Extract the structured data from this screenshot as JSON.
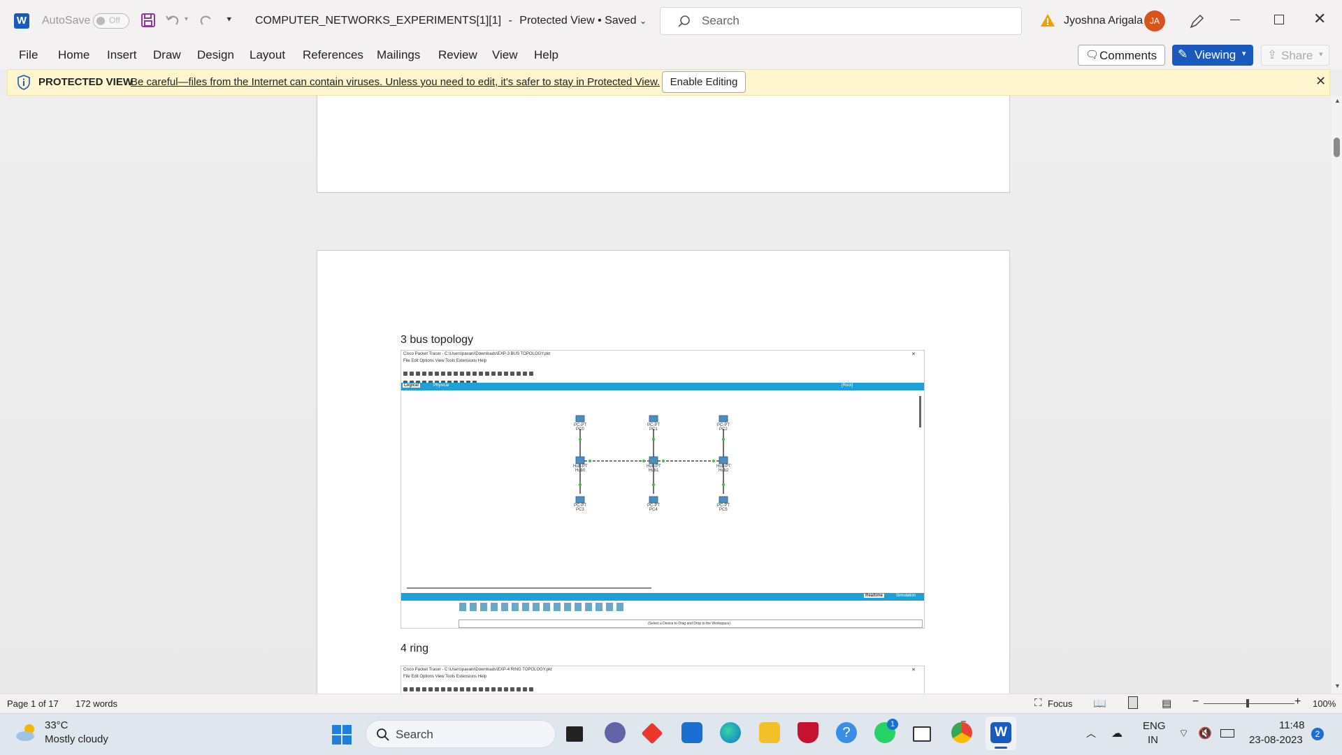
{
  "titlebar": {
    "autosave_label": "AutoSave",
    "autosave_state": "Off",
    "document_title": "COMPUTER_NETWORKS_EXPERIMENTS[1][1]",
    "separator": "-",
    "view_status": "Protected View • Saved",
    "search_placeholder": "Search",
    "user_name": "Jyoshna Arigala",
    "user_initials": "JA"
  },
  "ribbon": {
    "tabs": [
      "File",
      "Home",
      "Insert",
      "Draw",
      "Design",
      "Layout",
      "References",
      "Mailings",
      "Review",
      "View",
      "Help"
    ],
    "comments_label": "Comments",
    "viewing_label": "Viewing",
    "share_label": "Share"
  },
  "banner": {
    "title": "PROTECTED VIEW",
    "message": "Be careful—files from the Internet can contain viruses. Unless you need to edit, it's safer to stay in Protected View.",
    "enable_label": "Enable Editing"
  },
  "document": {
    "heading_bus": "3 bus topology",
    "heading_ring": "4 ring",
    "pkt_bus": {
      "title": "Cisco Packet Tracer - C:\\Users\\pavani\\Downloads\\EXP-3 BUS TOPOLOGY.pkt",
      "menus": "File   Edit   Options   View   Tools   Extensions   Help",
      "tab_logical": "Logical",
      "tab_physical": "Physical",
      "root": "[Root]",
      "realtime": "Realtime",
      "simulation": "Simulation",
      "hint": "(Select a Device to Drag and Drop to the Workspace)",
      "hubs": [
        "Hub0",
        "Hub1",
        "Hub2"
      ],
      "pcs_top": [
        "PC0",
        "PC1",
        "PC2"
      ],
      "pcs_bottom": [
        "PC3",
        "PC4",
        "PC5"
      ],
      "pc_type": "PC-PT",
      "hub_type": "Hub-PT"
    },
    "pkt_ring": {
      "title": "Cisco Packet Tracer - C:\\Users\\pavani\\Downloads\\EXP-4 RING TOPOLOGY.pkt",
      "menus": "File   Edit   Options   View   Tools   Extensions   Help"
    }
  },
  "statusbar": {
    "page": "Page 1 of 17",
    "words": "172 words",
    "focus": "Focus",
    "zoom": "100%"
  },
  "taskbar": {
    "temperature": "33°C",
    "weather": "Mostly cloudy",
    "search_label": "Search",
    "lang_line1": "ENG",
    "lang_line2": "IN",
    "time": "11:48",
    "date": "23-08-2023",
    "notifications": "2",
    "whatsapp_badge": "1"
  },
  "colors": {
    "accent": "#185abd",
    "banner_bg": "#fdf6cf",
    "pkt_blue": "#1ea1d8"
  }
}
